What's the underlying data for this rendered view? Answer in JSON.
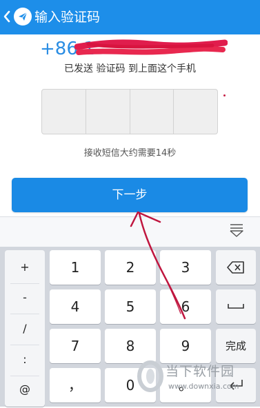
{
  "header": {
    "title": "输入验证码",
    "back_icon": "chevron-left-icon",
    "app_icon": "paper-plane-icon",
    "color": "#1d8ee9"
  },
  "phone": {
    "prefix": "+86 1"
  },
  "messages": {
    "sent": "已发送 验证码 到上面这个手机",
    "wait": "接收短信大约需要14秒"
  },
  "next_button": {
    "label": "下一步",
    "color": "#1a8ae5"
  },
  "keyboard": {
    "symbols": [
      "+",
      "-",
      "/",
      ":",
      "@"
    ],
    "digits": [
      "1",
      "2",
      "3",
      "4",
      "5",
      "6",
      "7",
      "8",
      "9",
      "，",
      "0",
      "。"
    ],
    "done_label": "完成",
    "backspace_icon": "backspace-icon",
    "space_icon": "space-icon",
    "return_icon": "return-icon",
    "hide_icon": "keyboard-hide-icon"
  },
  "watermark": {
    "name": "当下软件园",
    "url": "www.downxia.com"
  },
  "annotation_color": "#c0163f"
}
